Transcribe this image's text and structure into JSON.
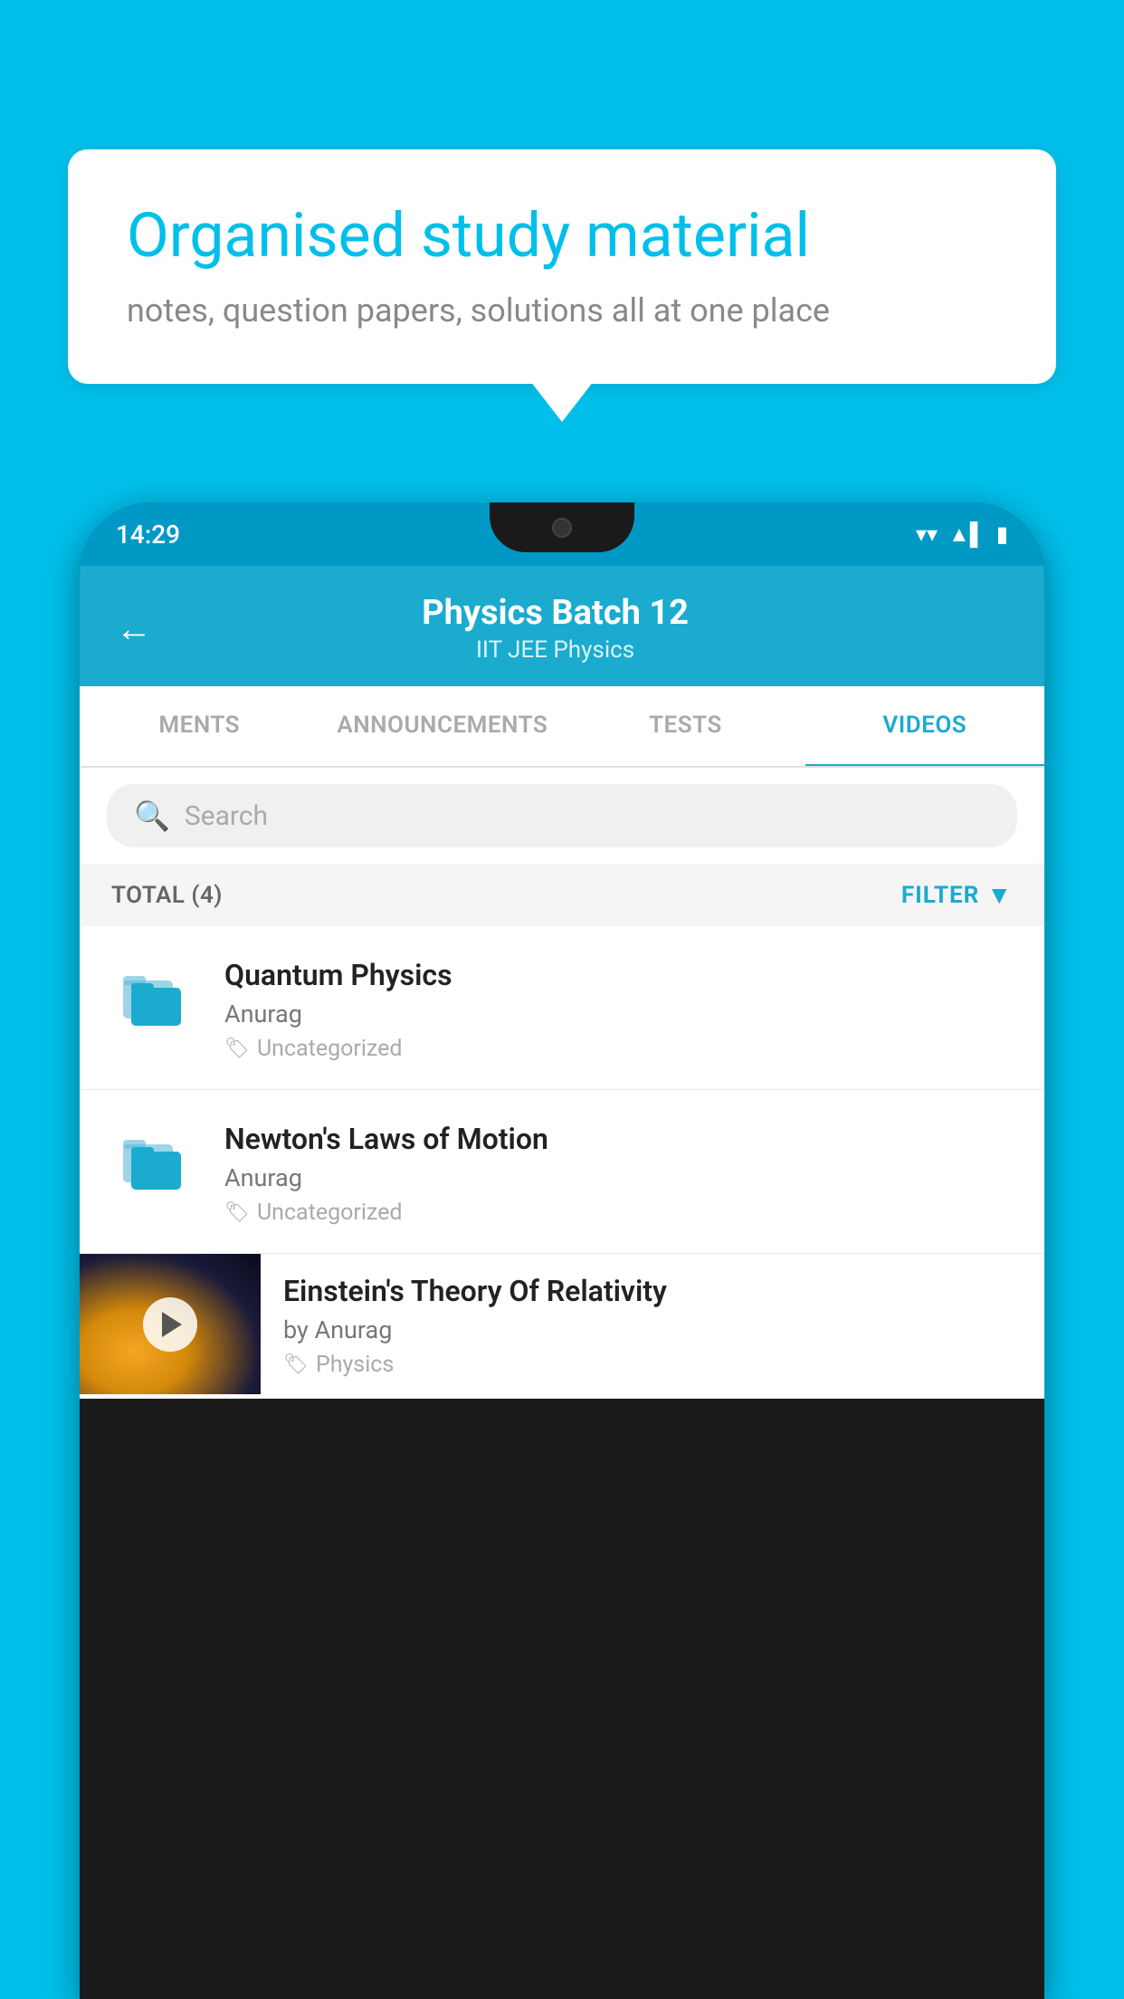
{
  "background_color": "#00BFEA",
  "bubble": {
    "title": "Organised study material",
    "subtitle": "notes, question papers, solutions all at one place"
  },
  "phone": {
    "status_bar": {
      "time": "14:29",
      "wifi_icon": "▼",
      "signal_icon": "▲",
      "battery_icon": "▮"
    },
    "header": {
      "back_label": "←",
      "title": "Physics Batch 12",
      "breadcrumb": "IIT JEE   Physics"
    },
    "tabs": [
      {
        "label": "MENTS",
        "active": false
      },
      {
        "label": "ANNOUNCEMENTS",
        "active": false
      },
      {
        "label": "TESTS",
        "active": false
      },
      {
        "label": "VIDEOS",
        "active": true
      }
    ],
    "search": {
      "placeholder": "Search"
    },
    "filter_bar": {
      "total": "TOTAL (4)",
      "filter_label": "FILTER"
    },
    "videos": [
      {
        "title": "Quantum Physics",
        "author": "Anurag",
        "tag": "Uncategorized",
        "has_thumbnail": false
      },
      {
        "title": "Newton's Laws of Motion",
        "author": "Anurag",
        "tag": "Uncategorized",
        "has_thumbnail": false
      },
      {
        "title": "Einstein's Theory Of Relativity",
        "author": "by Anurag",
        "tag": "Physics",
        "has_thumbnail": true
      }
    ]
  }
}
